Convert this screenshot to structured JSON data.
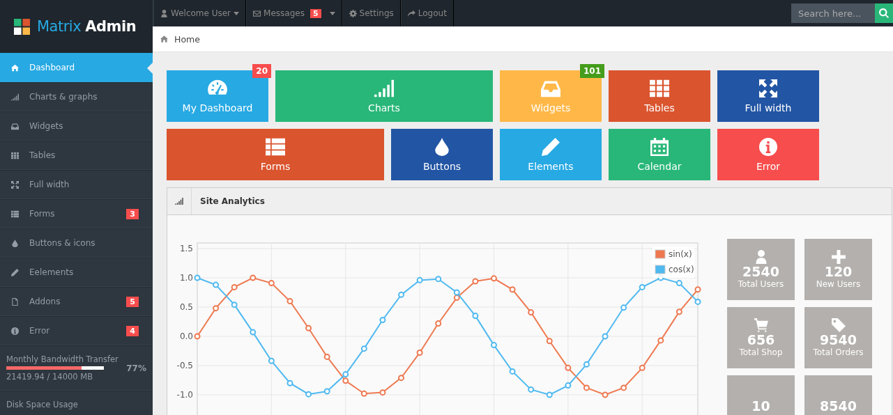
{
  "brand": {
    "part_1": "Matrix",
    "part_2": "Admin"
  },
  "top_nav": [
    {
      "label": "Welcome User",
      "kind": "dropdown"
    },
    {
      "label": "Messages",
      "kind": "messages",
      "badge": "5"
    },
    {
      "label": "Settings",
      "kind": "settings"
    },
    {
      "label": "Logout",
      "kind": "logout"
    }
  ],
  "search": {
    "placeholder": "Search here..."
  },
  "breadcrumb": "Home",
  "sidebar": {
    "items": [
      {
        "label": "Dashboard",
        "selected": true
      },
      {
        "label": "Charts & graphs",
        "selected": false
      },
      {
        "label": "Widgets",
        "selected": false
      },
      {
        "label": "Tables",
        "selected": false
      },
      {
        "label": "Full width",
        "selected": false
      },
      {
        "label": "Forms",
        "selected": false,
        "badge": "3"
      },
      {
        "label": "Buttons & icons",
        "selected": false
      },
      {
        "label": "Eelements",
        "selected": false
      },
      {
        "label": "Addons",
        "selected": false,
        "badge": "5"
      },
      {
        "label": "Error",
        "selected": false,
        "badge": "4"
      }
    ],
    "bandwidth": {
      "title": "Monthly Bandwidth Transfer",
      "level": 0.77,
      "percent": "77%",
      "reading": "21419.94 / 14000 MB"
    },
    "disk": {
      "title": "Disk Space Usage"
    }
  },
  "tiles": [
    [
      {
        "label": "My Dashboard",
        "color": "#27a9e3",
        "badge": {
          "text": "20",
          "color": "#f74d4d"
        }
      },
      {
        "label": "Charts",
        "color": "#28b779"
      },
      {
        "label": "Widgets",
        "color": "#ffb848",
        "badge": {
          "text": "101",
          "color": "#459d1c"
        }
      },
      {
        "label": "Tables",
        "color": "#da542e"
      },
      {
        "label": "Full width",
        "color": "#2255a4"
      }
    ],
    [
      {
        "label": "Forms",
        "color": "#da542e"
      },
      {
        "label": "Buttons",
        "color": "#2255a4"
      },
      {
        "label": "Elements",
        "color": "#27a9e3"
      },
      {
        "label": "Calendar",
        "color": "#28b779"
      },
      {
        "label": "Error",
        "color": "#f74d4d"
      }
    ]
  ],
  "analytics": {
    "title": "Site Analytics",
    "chart_data": {
      "type": "line",
      "categories": [
        null,
        null,
        null,
        null,
        null,
        null,
        null,
        null,
        null,
        null,
        null,
        null,
        null,
        null,
        null,
        null,
        null,
        null,
        null,
        null,
        null,
        null,
        null,
        null,
        null,
        null,
        null,
        null
      ],
      "grid": true,
      "legend": "upper right",
      "series": [
        {
          "name": "sin(x)",
          "color": "#ee7951",
          "marker": "circle",
          "values": [
            0,
            0.48,
            0.84,
            1.0,
            0.91,
            0.6,
            0.14,
            -0.35,
            -0.76,
            -0.98,
            -0.96,
            -0.71,
            -0.28,
            0.22,
            0.66,
            0.94,
            0.99,
            0.8,
            0.41,
            -0.08,
            -0.54,
            -0.88,
            -1.0,
            -0.88,
            -0.54,
            -0.07,
            0.42,
            0.8
          ]
        },
        {
          "name": "cos(x)",
          "color": "#4fb9f0",
          "marker": "circle",
          "values": [
            1.0,
            0.88,
            0.54,
            0.07,
            -0.42,
            -0.8,
            -0.99,
            -0.94,
            -0.65,
            -0.21,
            0.28,
            0.71,
            0.96,
            0.98,
            0.75,
            0.35,
            -0.15,
            -0.6,
            -0.91,
            -1.0,
            -0.84,
            -0.48,
            0.0,
            0.49,
            0.84,
            1.0,
            0.91,
            0.59
          ]
        }
      ],
      "ylim": [
        -1.5,
        1.5
      ],
      "yticks": [
        {
          "value": 1.5,
          "label": "1.5"
        },
        {
          "value": 1,
          "label": "1.0"
        },
        {
          "value": 0.5,
          "label": "0.5"
        },
        {
          "value": 0,
          "label": "0.0"
        },
        {
          "value": -0.5,
          "label": "-0.5"
        },
        {
          "value": -1,
          "label": "-1.0"
        }
      ]
    },
    "stats": [
      {
        "value": "2540",
        "label": "Total Users"
      },
      {
        "value": "120",
        "label": "New Users"
      },
      {
        "value": "656",
        "label": "Total Shop"
      },
      {
        "value": "9540",
        "label": "Total Orders"
      },
      {
        "value": "10"
      },
      {
        "value": "8540"
      }
    ]
  }
}
